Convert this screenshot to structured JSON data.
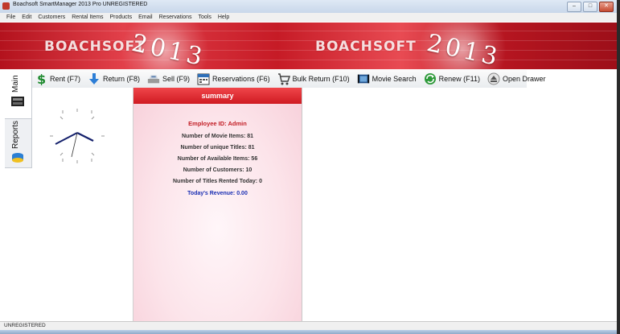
{
  "window": {
    "title": "Boachsoft SmartManager 2013 Pro  UNREGISTERED"
  },
  "menu": [
    "File",
    "Edit",
    "Customers",
    "Rental Items",
    "Products",
    "Email",
    "Reservations",
    "Tools",
    "Help"
  ],
  "banner": {
    "brand": "BOACHSOFT",
    "year": "2013"
  },
  "toolbar": {
    "rent": "Rent (F7)",
    "return": "Return (F8)",
    "sell": "Sell (F9)",
    "reservations": "Reservations (F6)",
    "bulk_return": "Bulk Return (F10)",
    "movie_search": "Movie Search",
    "renew": "Renew (F11)",
    "open_drawer": "Open Drawer"
  },
  "sidetabs": {
    "main": "Main",
    "reports": "Reports"
  },
  "summary": {
    "header": "summary",
    "employee": "Employee ID: Admin",
    "movie_items": "Number of Movie Items: 81",
    "unique_titles": "Number of unique Titles: 81",
    "available_items": "Number of Available Items: 56",
    "customers": "Number of Customers: 10",
    "titles_rented_today": "Number of Titles Rented Today: 0",
    "revenue": "Today's Revenue:  0.00"
  },
  "status": {
    "text": "UNREGISTERED"
  },
  "colors": {
    "banner_red": "#c61b26",
    "summary_header": "#e0262d",
    "revenue_blue": "#1a2fb3"
  }
}
